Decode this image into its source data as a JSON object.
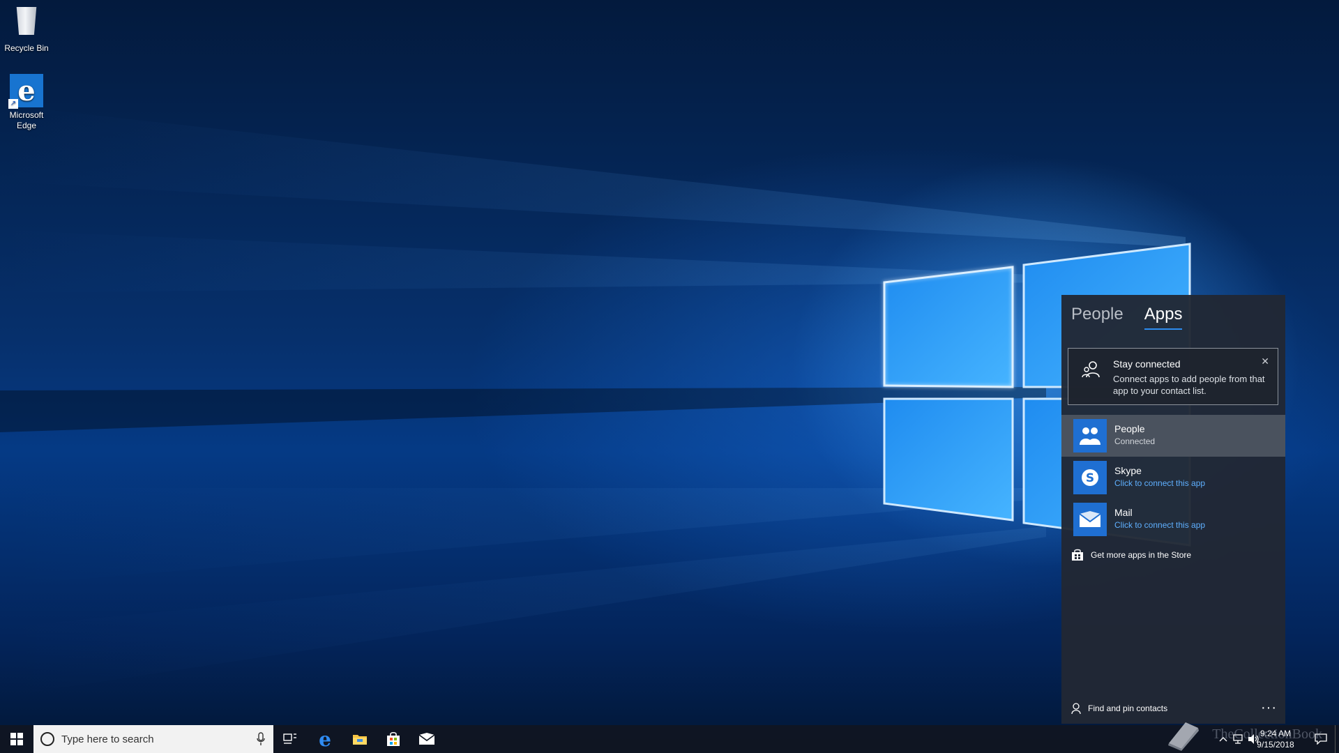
{
  "desktop": {
    "icons": [
      {
        "label": "Recycle Bin",
        "icon": "recycle-bin-icon"
      },
      {
        "label": "Microsoft Edge",
        "icon": "edge-icon"
      }
    ]
  },
  "people_flyout": {
    "tabs": [
      {
        "label": "People",
        "active": false
      },
      {
        "label": "Apps",
        "active": true
      }
    ],
    "banner": {
      "title": "Stay connected",
      "text": "Connect apps to add people from that app to your contact list.",
      "close_glyph": "✕"
    },
    "apps": [
      {
        "name": "People",
        "status": "Connected",
        "icon": "people-icon",
        "selected": true
      },
      {
        "name": "Skype",
        "status": "Click to connect this app",
        "icon": "skype-icon",
        "selected": false
      },
      {
        "name": "Mail",
        "status": "Click to connect this app",
        "icon": "mail-icon",
        "selected": false
      }
    ],
    "store_link": "Get more apps in the Store",
    "footer": {
      "find_pin": "Find and pin contacts",
      "more": "···"
    }
  },
  "taskbar": {
    "search_placeholder": "Type here to search",
    "pinned": [
      "task-view-icon",
      "edge-icon",
      "file-explorer-icon",
      "store-icon",
      "mail-icon"
    ],
    "clock": {
      "time": "9:24 AM",
      "date": "9/15/2018"
    },
    "watermark": "TheCollectionBook"
  },
  "colors": {
    "accent": "#1f6fd2",
    "link": "#5fb0ff",
    "flyout_bg": "#212834",
    "selected_row": "#4a525e",
    "taskbar_bg": "#101622"
  }
}
